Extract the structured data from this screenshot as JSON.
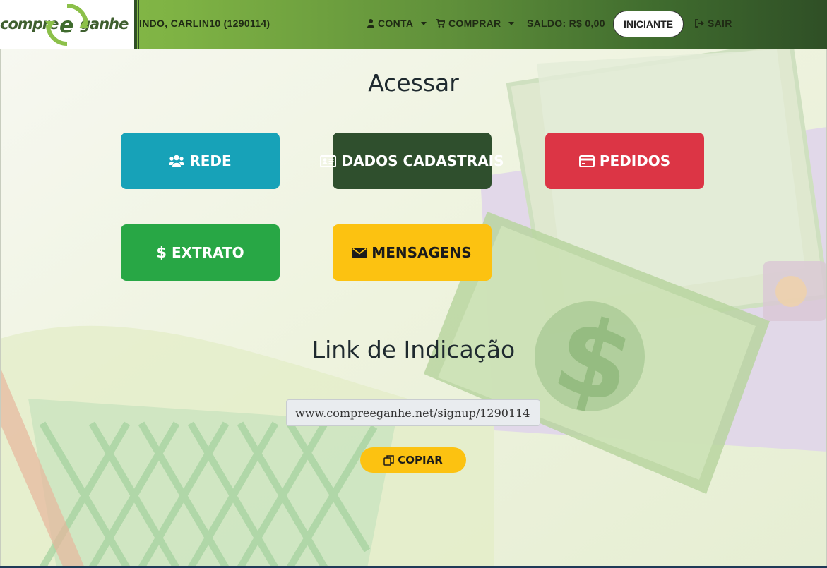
{
  "header": {
    "logo_text_left": "compre",
    "logo_text_right": "ganhe",
    "welcome": "INDO, CARLIN10 (1290114)",
    "nav": {
      "account": "CONTA",
      "buy": "COMPRAR",
      "balance": "SALDO: R$ 0,00",
      "level": "INICIANTE",
      "logout": "SAIR"
    }
  },
  "access": {
    "title": "Acessar",
    "tiles": [
      {
        "label": "REDE",
        "icon": "users-icon",
        "color": "#17a2b8"
      },
      {
        "label": "DADOS CADASTRAIS",
        "icon": "id-card-icon",
        "color": "#2f4f2d"
      },
      {
        "label": "PEDIDOS",
        "icon": "credit-card-icon",
        "color": "#dc3545"
      },
      {
        "label": "EXTRATO",
        "icon": "dollar-icon",
        "color": "#28a745"
      },
      {
        "label": "MENSAGENS",
        "icon": "envelope-icon",
        "color": "#fcc211"
      }
    ]
  },
  "referral": {
    "title": "Link de Indicação",
    "url": "www.compreeganhe.net/signup/1290114",
    "copy_label": "COPIAR"
  }
}
